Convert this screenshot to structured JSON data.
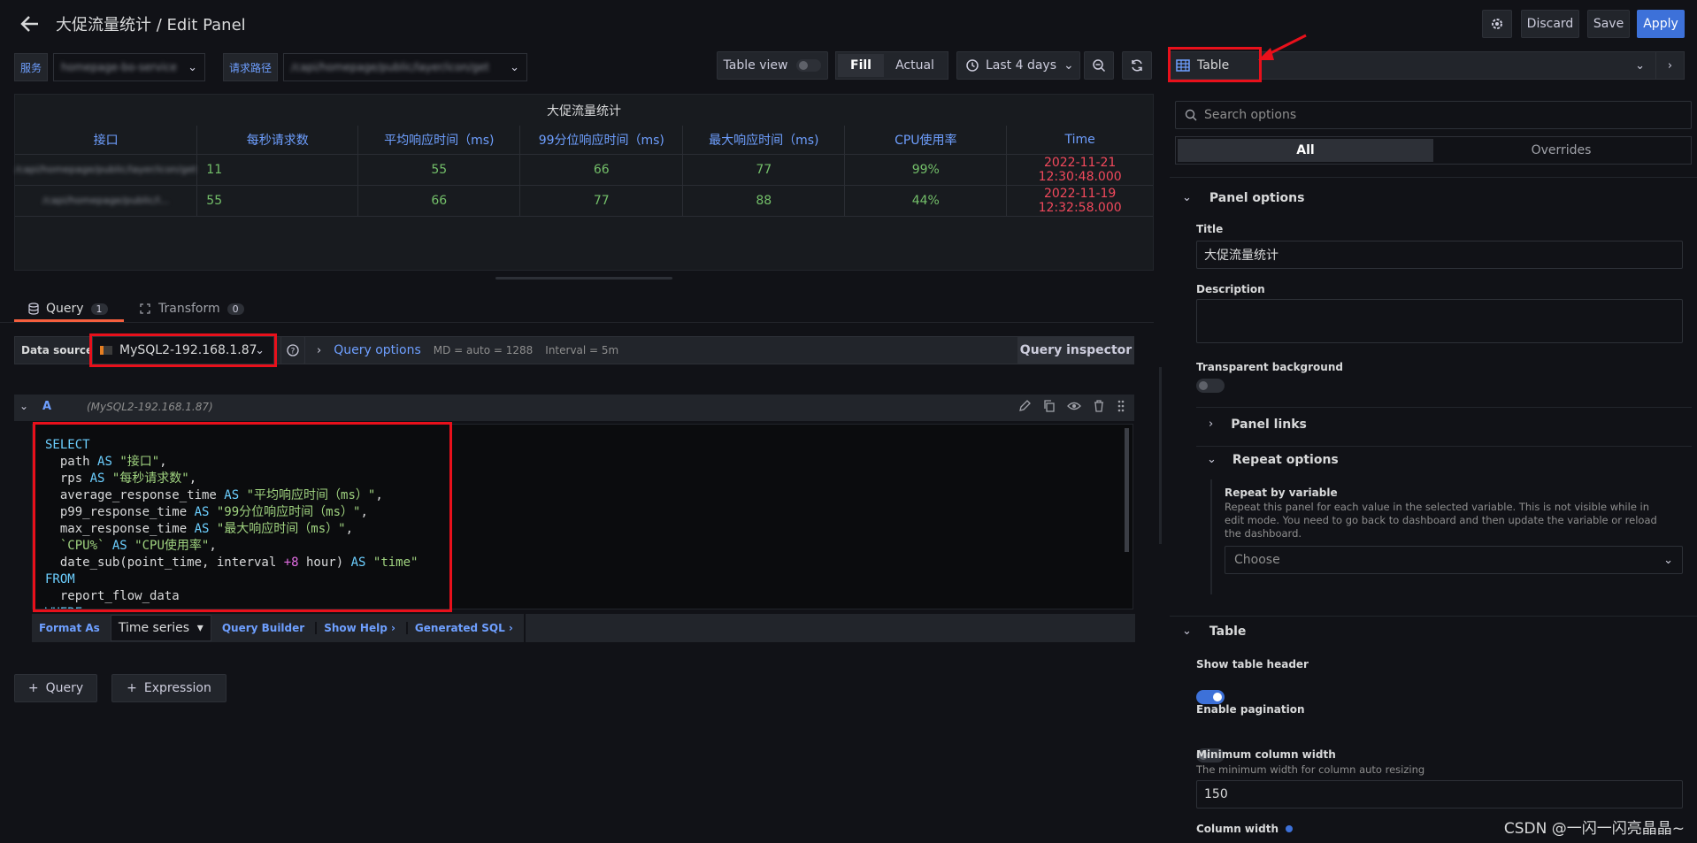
{
  "header": {
    "back_icon": "arrow-left-icon",
    "title": "大促流量统计 / Edit Panel",
    "settings_icon": "gear-icon",
    "discard": "Discard",
    "save": "Save",
    "apply": "Apply"
  },
  "vars": [
    {
      "label": "服务",
      "value": "homepage-bo-service"
    },
    {
      "label": "请求路径",
      "value": "/capi/homepage/public/layer/icon/get"
    }
  ],
  "toolbar": {
    "table_view": "Table view",
    "fill": "Fill",
    "actual": "Actual",
    "time_range": "Last 4 days",
    "viz_name": "Table"
  },
  "table": {
    "title": "大促流量统计",
    "columns": [
      "接口",
      "每秒请求数",
      "平均响应时间（ms)",
      "99分位响应时间（ms)",
      "最大响应时间（ms)",
      "CPU使用率",
      "Time"
    ],
    "rows": [
      [
        "/capi/homepage/public/layer/icon/get",
        "11",
        "55",
        "66",
        "77",
        "99%",
        "2022-11-21 12:30:48.000"
      ],
      [
        "/capi/homepage/public/l...",
        "55",
        "66",
        "77",
        "88",
        "44%",
        "2022-11-19 12:32:58.000"
      ]
    ]
  },
  "query_tabs": {
    "query": "Query",
    "query_count": "1",
    "transform": "Transform",
    "transform_count": "0"
  },
  "datasource": {
    "label": "Data source",
    "name": "MySQL2-192.168.1.87",
    "query_options": "Query options",
    "md": "MD = auto = 1288",
    "interval": "Interval = 5m",
    "inspector": "Query inspector"
  },
  "query_row": {
    "ref": "A",
    "source": "(MySQL2-192.168.1.87)"
  },
  "sql_footer": {
    "format_as": "Format As",
    "format_value": "Time series",
    "query_builder": "Query Builder",
    "show_help": "Show Help ›",
    "generated_sql": "Generated SQL ›"
  },
  "add_buttons": {
    "query": "Query",
    "expression": "Expression"
  },
  "options": {
    "search_placeholder": "Search options",
    "tab_all": "All",
    "tab_overrides": "Overrides",
    "panel_options": "Panel options",
    "title_label": "Title",
    "title_value": "大促流量统计",
    "description_label": "Description",
    "transparent_label": "Transparent background",
    "panel_links": "Panel links",
    "repeat_options": "Repeat options",
    "repeat_var_label": "Repeat by variable",
    "repeat_var_desc": "Repeat this panel for each value in the selected variable. This is not visible while in edit mode. You need to go back to dashboard and then update the variable or reload the dashboard.",
    "choose": "Choose",
    "table_section": "Table",
    "show_header": "Show table header",
    "show_header_on": true,
    "pagination": "Enable pagination",
    "min_col_label": "Minimum column width",
    "min_col_desc": "The minimum width for column auto resizing",
    "min_col_value": "150",
    "col_width": "Column width"
  },
  "watermark": "CSDN @一闪一闪亮晶晶~"
}
